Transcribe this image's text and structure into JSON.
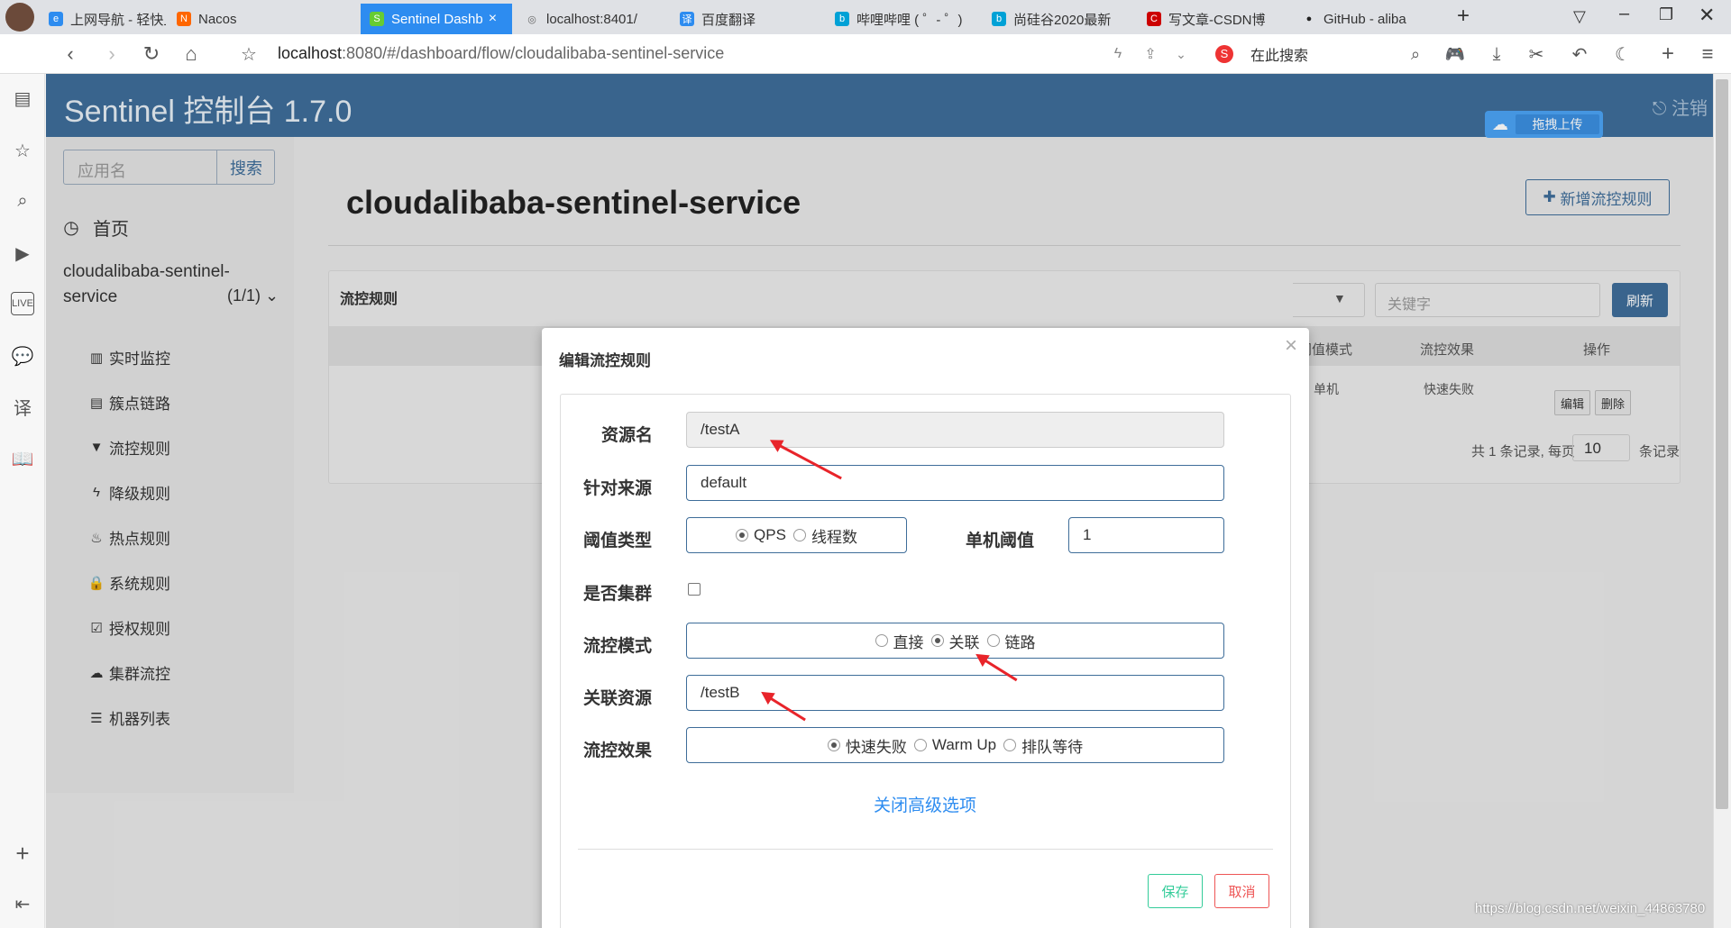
{
  "browser": {
    "tabs": [
      {
        "label": "上网导航 - 轻快上",
        "fav": "e",
        "color": "#2d8cf0"
      },
      {
        "label": "Nacos",
        "fav": "N",
        "color": "#f60"
      },
      {
        "label": "Sentinel Dashb",
        "fav": "S",
        "color": "#6c3"
      },
      {
        "label": "localhost:8401/",
        "fav": "◎",
        "color": "#666"
      },
      {
        "label": "百度翻译",
        "fav": "译",
        "color": "#2d8cf0"
      },
      {
        "label": "哔哩哔哩 ( ゜- ゜)",
        "fav": "b",
        "color": "#00a1d6"
      },
      {
        "label": "尚硅谷2020最新",
        "fav": "b",
        "color": "#00a1d6"
      },
      {
        "label": "写文章-CSDN博",
        "fav": "C",
        "color": "#c00"
      },
      {
        "label": "GitHub - aliba",
        "fav": "●",
        "color": "#222"
      }
    ],
    "url_host": "localhost",
    "url_path": ":8080/#/dashboard/flow/cloudalibaba-sentinel-service",
    "search_label": "在此搜索"
  },
  "app": {
    "title": "Sentinel 控制台 1.7.0",
    "logout": "注销",
    "upload_label": "拖拽上传",
    "search_placeholder": "应用名",
    "search_button": "搜索",
    "home": "首页",
    "service_name": "cloudalibaba-sentinel-service",
    "service_count": "(1/1)",
    "nav": [
      {
        "label": "实时监控",
        "icon": "bar-chart-icon"
      },
      {
        "label": "簇点链路",
        "icon": "list-icon"
      },
      {
        "label": "流控规则",
        "icon": "filter-icon"
      },
      {
        "label": "降级规则",
        "icon": "bolt-icon"
      },
      {
        "label": "热点规则",
        "icon": "fire-icon"
      },
      {
        "label": "系统规则",
        "icon": "lock-icon"
      },
      {
        "label": "授权规则",
        "icon": "check-icon"
      },
      {
        "label": "集群流控",
        "icon": "cloud-icon"
      },
      {
        "label": "机器列表",
        "icon": "list-icon"
      }
    ]
  },
  "main": {
    "page_title": "cloudalibaba-sentinel-service",
    "add_rule": "新增流控规则",
    "panel_title": "流控规则",
    "keyword_placeholder": "关键字",
    "refresh": "刷新",
    "columns": [
      "阈值模式",
      "流控效果",
      "操作"
    ],
    "row": {
      "mode": "单机",
      "effect": "快速失败",
      "edit": "编辑",
      "delete": "删除"
    },
    "pager_prefix": "共 1 条记录, 每页",
    "page_size": "10",
    "pager_suffix": "条记录"
  },
  "modal": {
    "title": "编辑流控规则",
    "close": "×",
    "fields": {
      "resource_label": "资源名",
      "resource_value": "/testA",
      "origin_label": "针对来源",
      "origin_value": "default",
      "grade_label": "阈值类型",
      "grade_options": [
        "QPS",
        "线程数"
      ],
      "threshold_label": "单机阈值",
      "threshold_value": "1",
      "cluster_label": "是否集群",
      "strategy_label": "流控模式",
      "strategy_options": [
        "直接",
        "关联",
        "链路"
      ],
      "ref_label": "关联资源",
      "ref_value": "/testB",
      "effect_label": "流控效果",
      "effect_options": [
        "快速失败",
        "Warm Up",
        "排队等待"
      ]
    },
    "advanced_link": "关闭高级选项",
    "save": "保存",
    "cancel": "取消"
  },
  "watermark": "https://blog.csdn.net/weixin_44863780"
}
